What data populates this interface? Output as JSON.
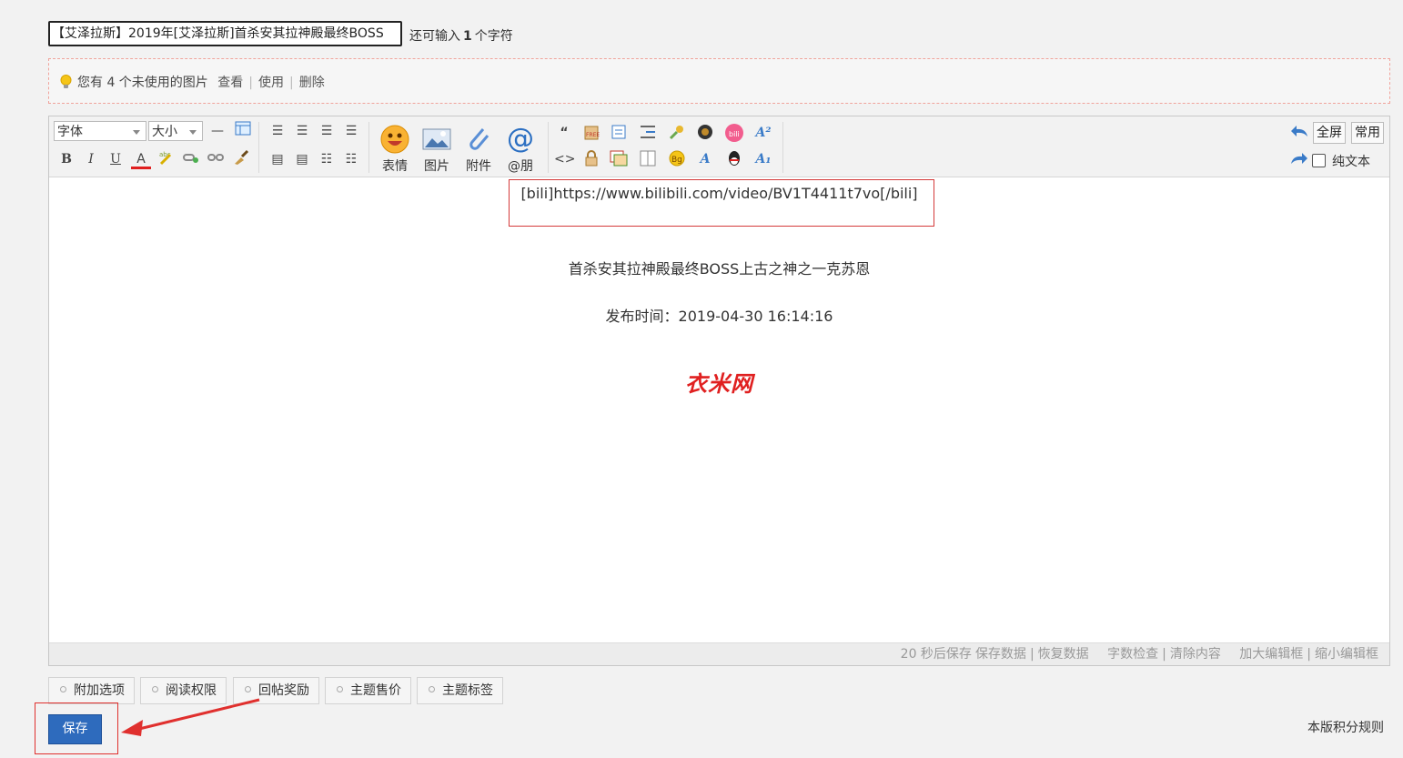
{
  "title": {
    "value": "【艾泽拉斯】2019年[艾泽拉斯]首杀安其拉神殿最终BOSS",
    "hint_prefix": "还可输入",
    "hint_count": "1",
    "hint_suffix": "个字符"
  },
  "notice": {
    "text": "您有 4 个未使用的图片",
    "view": "查看",
    "use": "使用",
    "delete": "删除",
    "sep": "|"
  },
  "toolbar": {
    "font_label": "字体",
    "size_label": "大小",
    "emoji_label": "表情",
    "image_label": "图片",
    "attach_label": "附件",
    "at_label": "@朋",
    "fullscreen_label": "全屏",
    "common_label": "常用",
    "plaintext_label": "纯文本",
    "bold": "B",
    "italic": "I",
    "underline": "U",
    "color": "A",
    "quote": "“",
    "code": "<>"
  },
  "content": {
    "bili_line": "[bili]https://www.bilibili.com/video/BV1T4411t7vo[/bili]",
    "subtitle": "首杀安其拉神殿最终BOSS上古之神之一克苏恩",
    "date_line": "发布时间：2019-04-30 16:14:16",
    "logo_text": "衣米网"
  },
  "statusbar": {
    "autosave": "20 秒后保存",
    "save_data": "保存数据",
    "restore_data": "恢复数据",
    "word_check": "字数检查",
    "clear": "清除内容",
    "enlarge": "加大编辑框",
    "shrink": "缩小编辑框",
    "sep": "|"
  },
  "tabs": [
    "附加选项",
    "阅读权限",
    "回帖奖励",
    "主题售价",
    "主题标签"
  ],
  "save_label": "保存",
  "rules_link": "本版积分规则",
  "colors": {
    "accent": "#2e6bbd",
    "highlight_red": "#d43a3a",
    "logo_red": "#e02020"
  }
}
